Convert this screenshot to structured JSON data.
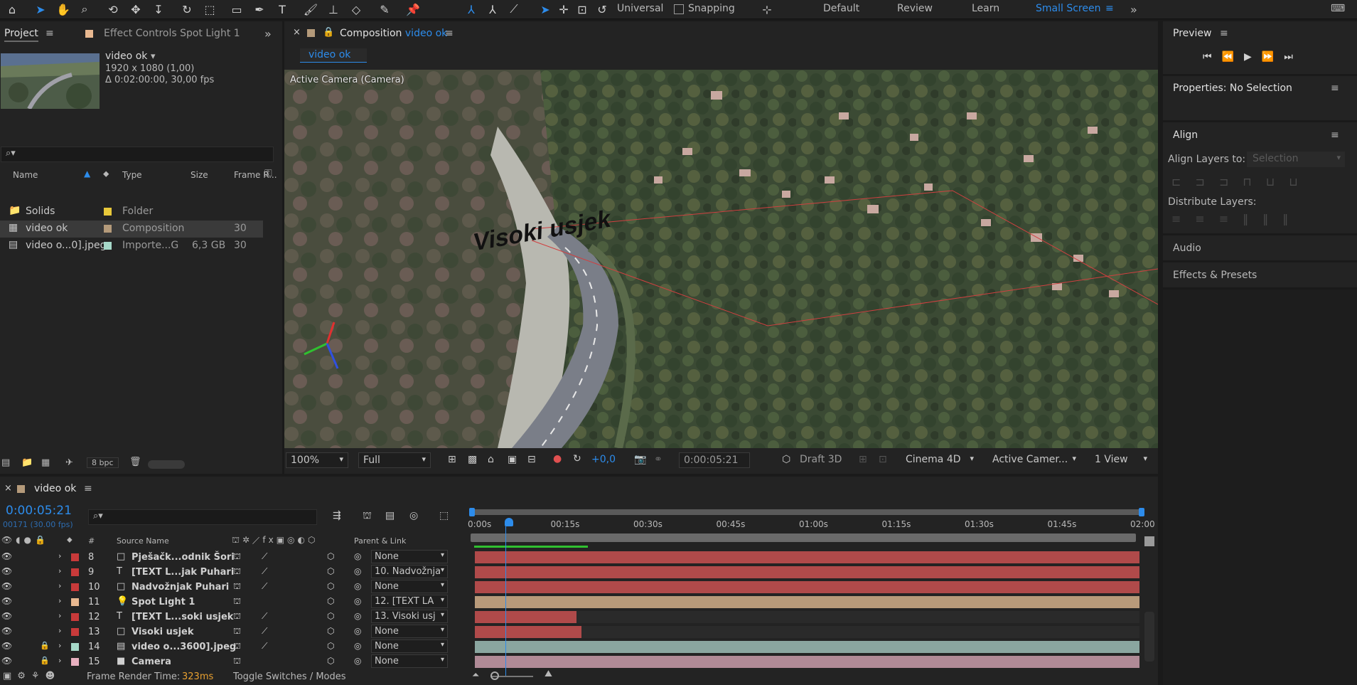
{
  "toolbar": {
    "workspaces": [
      "Default",
      "Review",
      "Learn",
      "Small Screen"
    ],
    "active_workspace": "Small Screen",
    "axis_mode": "Universal",
    "snapping_label": "Snapping"
  },
  "project_panel": {
    "tab_project": "Project",
    "tab_effect_controls": "Effect Controls Spot Light 1",
    "preview_name": "video ok",
    "preview_dims": "1920 x 1080 (1,00)",
    "preview_duration": "Δ 0:02:00:00, 30,00 fps",
    "columns": {
      "name": "Name",
      "type": "Type",
      "size": "Size",
      "frame_rate": "Frame R..."
    },
    "items": [
      {
        "name": "Solids",
        "type": "Folder",
        "size": "",
        "fps": "",
        "color": "#e8c83a",
        "icon": "folder-icon"
      },
      {
        "name": "video ok",
        "type": "Composition",
        "size": "",
        "fps": "30",
        "color": "#b49a7a",
        "icon": "composition-icon"
      },
      {
        "name": "video o...0].jpeg",
        "type": "Importe...G",
        "size": "6,3 GB",
        "fps": "30",
        "color": "#a6d8c8",
        "icon": "image-sequence-icon"
      }
    ],
    "bpc": "8 bpc"
  },
  "composition_panel": {
    "tab_label": "Composition",
    "tab_comp_name": "video ok",
    "breadcrumb": "video ok",
    "camera_label": "Active Camera (Camera)",
    "scene_text": "Visoki usjek",
    "zoom": "100%",
    "resolution": "Full",
    "exposure": "+0,0",
    "timecode": "0:00:05:21",
    "renderer_mode": "Draft 3D",
    "renderer": "Cinema 4D",
    "view_camera": "Active Camer...",
    "view_layout": "1 View"
  },
  "right_panels": {
    "preview": "Preview",
    "properties": "Properties: No Selection",
    "align": "Align",
    "align_layers_to": "Align Layers to:",
    "align_selection": "Selection",
    "distribute_layers": "Distribute Layers:",
    "audio": "Audio",
    "effects_presets": "Effects & Presets"
  },
  "timeline": {
    "tab_name": "video ok",
    "current_time": "0:00:05:21",
    "frame_info": "00171 (30.00 fps)",
    "col_number": "#",
    "col_source": "Source Name",
    "col_parent": "Parent & Link",
    "ruler": [
      "0:00s",
      "00:15s",
      "00:30s",
      "00:45s",
      "01:00s",
      "01:15s",
      "01:30s",
      "01:45s",
      "02:00"
    ],
    "layers": [
      {
        "num": "8",
        "name": "Pješačk...odnik Šori",
        "parent": "None",
        "label": "#c83a3a",
        "type": "solid",
        "bar": "#b04a4a",
        "bar_start": 0,
        "bar_end": 1
      },
      {
        "num": "9",
        "name": "[TEXT L...jak Puhari",
        "parent": "10. Nadvožnja",
        "label": "#c83a3a",
        "type": "text",
        "bar": "#b04a4a",
        "bar_start": 0,
        "bar_end": 1
      },
      {
        "num": "10",
        "name": "Nadvožnjak Puhari",
        "parent": "None",
        "label": "#c83a3a",
        "type": "solid",
        "bar": "#b04a4a",
        "bar_start": 0,
        "bar_end": 1
      },
      {
        "num": "11",
        "name": "Spot Light 1",
        "parent": "12. [TEXT LA",
        "label": "#e8b890",
        "type": "light",
        "bar": "#b89a7a",
        "bar_start": 0,
        "bar_end": 1
      },
      {
        "num": "12",
        "name": "[TEXT L...soki usjek",
        "parent": "13. Visoki usj",
        "label": "#c83a3a",
        "type": "text",
        "bar": "#b04a4a",
        "bar_start": 0,
        "bar_end": 0.153
      },
      {
        "num": "13",
        "name": "Visoki usjek",
        "parent": "None",
        "label": "#c83a3a",
        "type": "solid",
        "bar": "#b04a4a",
        "bar_start": 0,
        "bar_end": 0.16
      },
      {
        "num": "14",
        "name": "video o...3600].jpeg",
        "parent": "None",
        "label": "#a6d8c8",
        "type": "footage",
        "bar": "#8aa6a0",
        "bar_start": 0,
        "bar_end": 1
      },
      {
        "num": "15",
        "name": "Camera",
        "parent": "None",
        "label": "#e8b0c0",
        "type": "camera",
        "bar": "#b08a96",
        "bar_start": 0,
        "bar_end": 1
      }
    ],
    "frame_render_label": "Frame Render Time:",
    "frame_render_value": "323ms",
    "toggle_label": "Toggle Switches / Modes"
  }
}
